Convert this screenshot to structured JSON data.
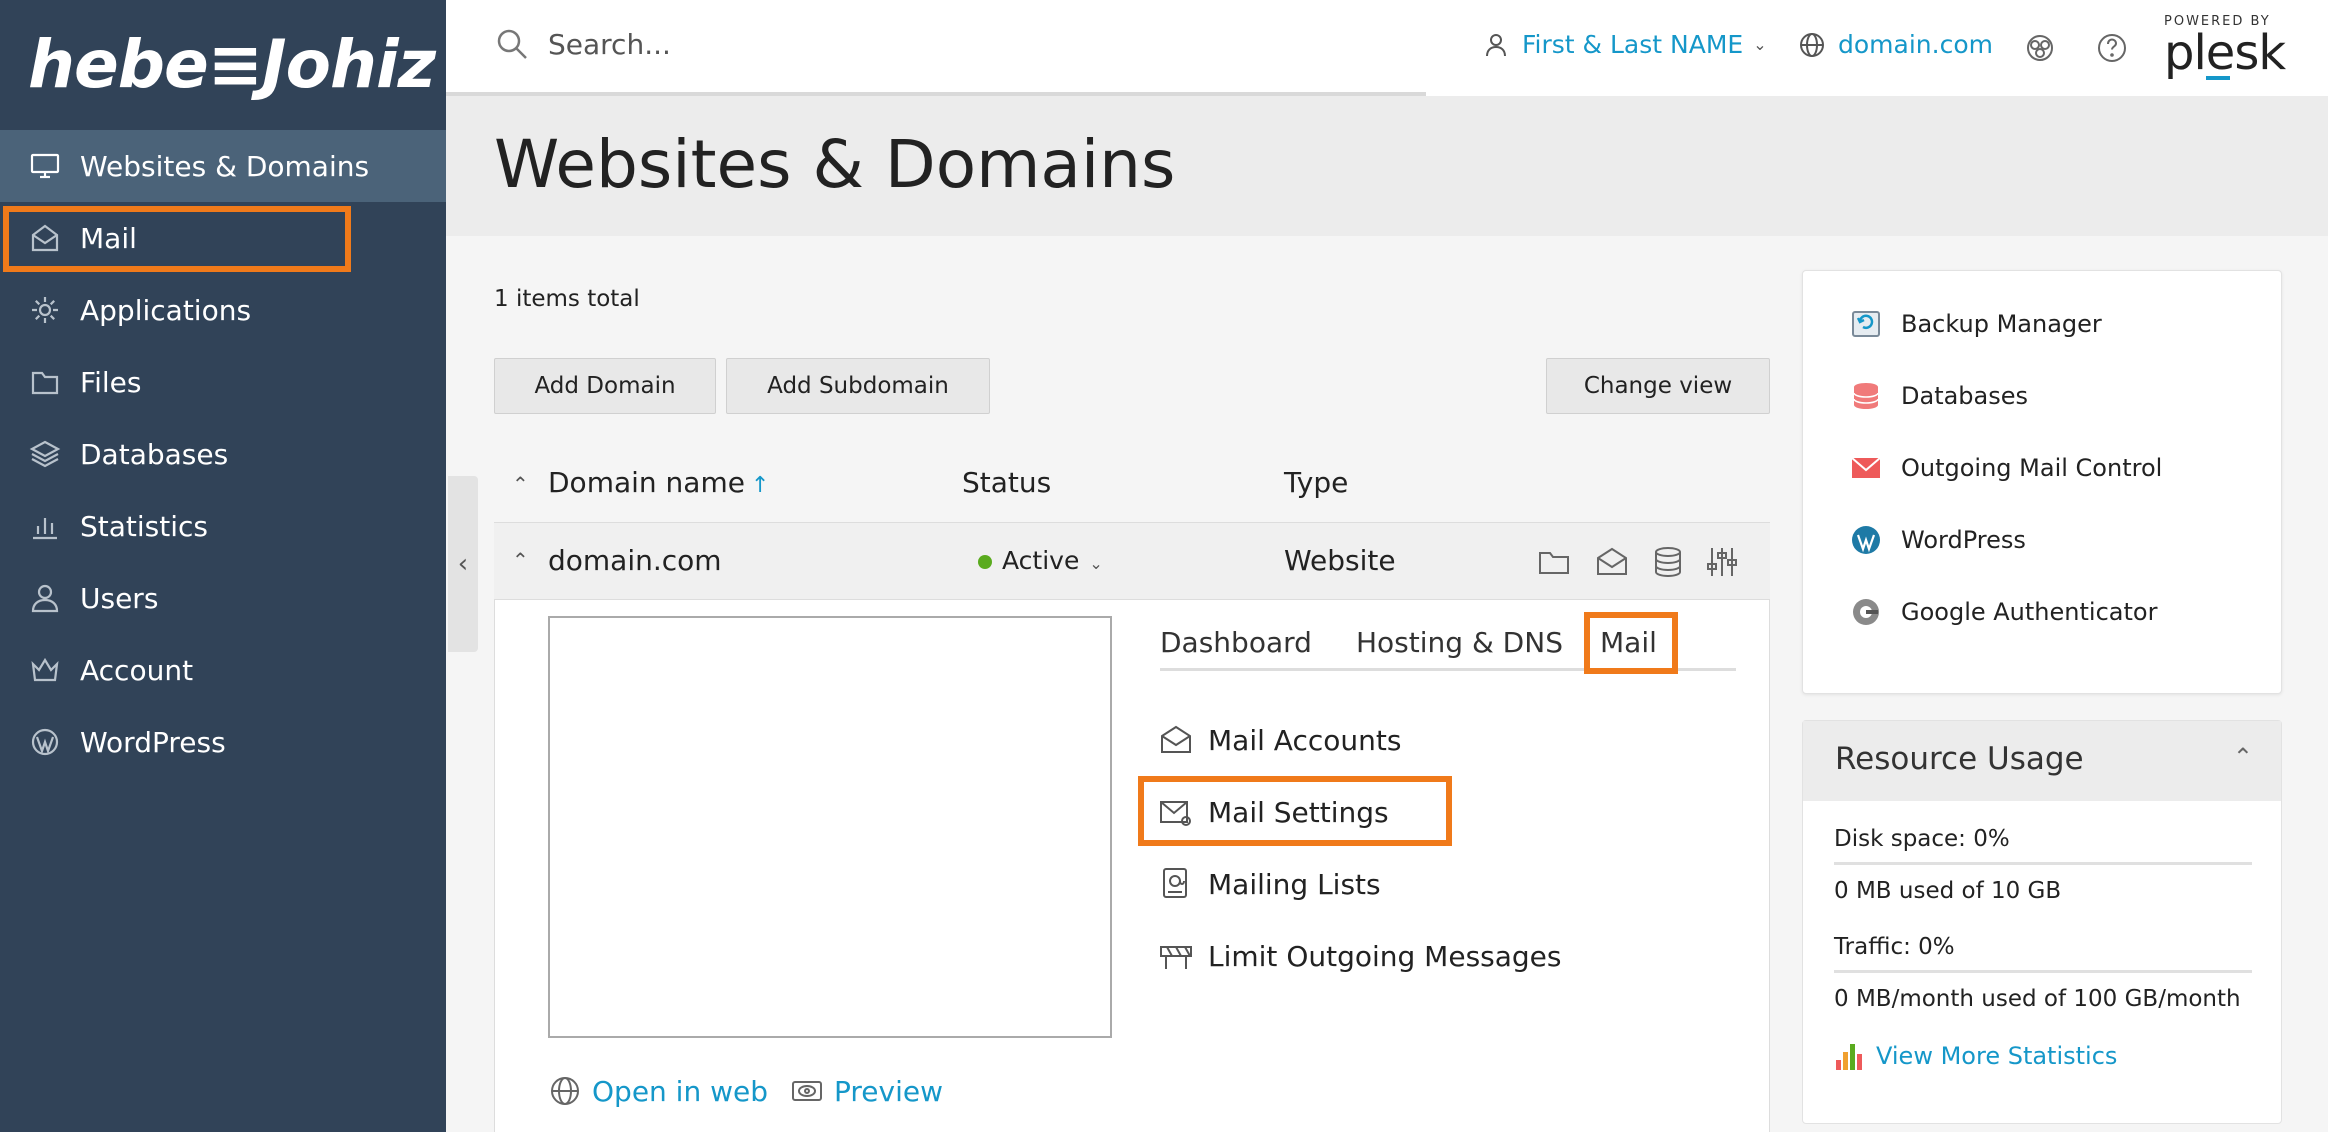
{
  "brand": {
    "logo_text": "hebe≡Johiz"
  },
  "header": {
    "search_placeholder": "Search...",
    "user_name": "First & Last NAME",
    "domain": "domain.com",
    "plesk_powered": "POWERED BY",
    "plesk_name": "plesk"
  },
  "sidebar": {
    "items": [
      {
        "label": "Websites & Domains",
        "icon": "monitor-icon"
      },
      {
        "label": "Mail",
        "icon": "mail-open-icon"
      },
      {
        "label": "Applications",
        "icon": "gear-icon"
      },
      {
        "label": "Files",
        "icon": "folder-icon"
      },
      {
        "label": "Databases",
        "icon": "layers-icon"
      },
      {
        "label": "Statistics",
        "icon": "bar-chart-icon"
      },
      {
        "label": "Users",
        "icon": "user-icon"
      },
      {
        "label": "Account",
        "icon": "crown-icon"
      },
      {
        "label": "WordPress",
        "icon": "wordpress-icon"
      }
    ]
  },
  "page": {
    "title": "Websites & Domains",
    "items_total": "1 items total",
    "buttons": {
      "add_domain": "Add Domain",
      "add_subdomain": "Add Subdomain",
      "change_view": "Change view"
    }
  },
  "table": {
    "columns": {
      "domain": "Domain name",
      "sort_arrow": "↑",
      "status": "Status",
      "type": "Type"
    },
    "row": {
      "domain": "domain.com",
      "status": "Active",
      "type": "Website"
    }
  },
  "domain_panel": {
    "tabs": [
      "Dashboard",
      "Hosting & DNS",
      "Mail"
    ],
    "mail_items": [
      "Mail Accounts",
      "Mail Settings",
      "Mailing Lists",
      "Limit Outgoing Messages"
    ],
    "links": {
      "open_in_web": "Open in web",
      "preview": "Preview"
    }
  },
  "tools": {
    "items": [
      "Backup Manager",
      "Databases",
      "Outgoing Mail Control",
      "WordPress",
      "Google Authenticator"
    ]
  },
  "resource_usage": {
    "title": "Resource Usage",
    "disk_label": "Disk space: 0%",
    "disk_used": 0,
    "disk_detail": "0 MB used of 10 GB",
    "traffic_label": "Traffic: 0%",
    "traffic_used": 0,
    "traffic_detail": "0 MB/month used of 100 GB/month",
    "more_link": "View More Statistics"
  },
  "colors": {
    "sidebar": "#314358",
    "accent": "#1597c9",
    "highlight": "#f07a1a",
    "active_status": "#5aab1e"
  }
}
